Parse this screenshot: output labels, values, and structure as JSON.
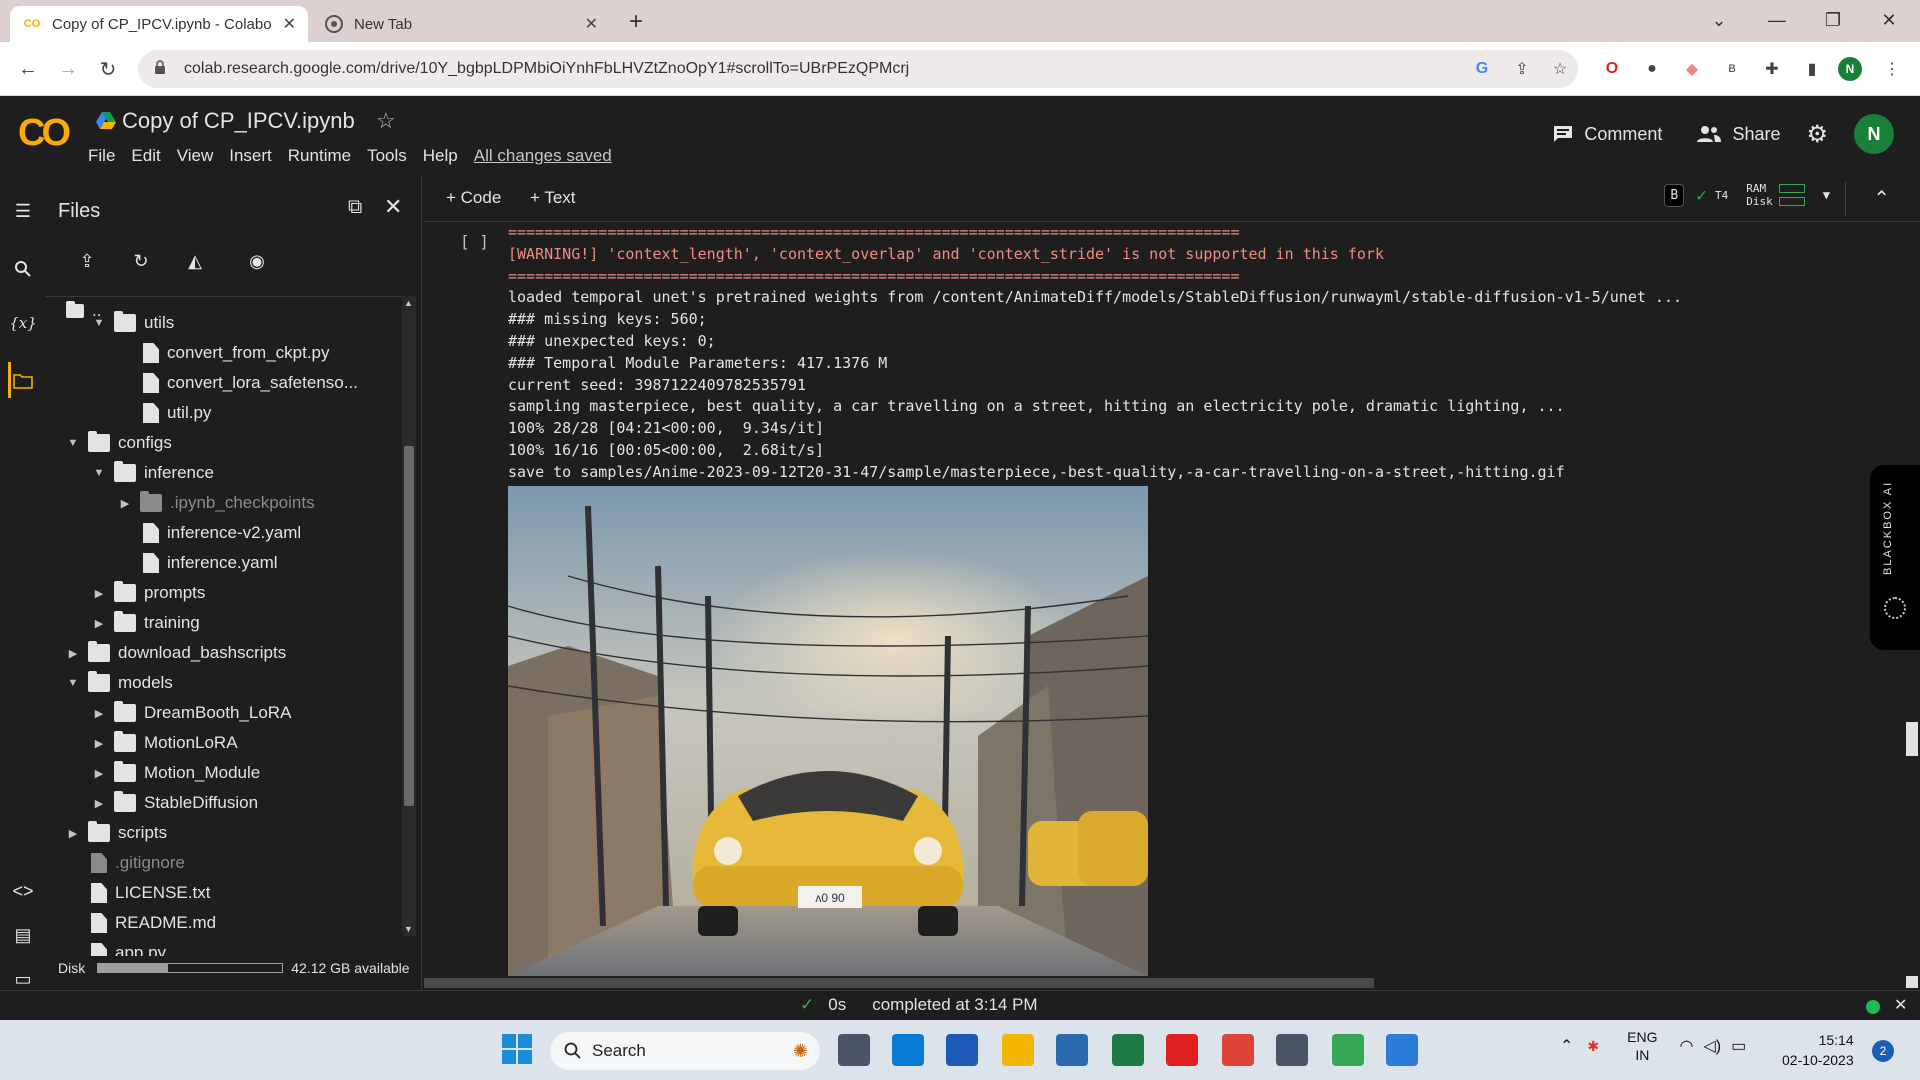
{
  "browser": {
    "tabs": [
      {
        "title": "Copy of CP_IPCV.ipynb - Colabo",
        "close": "✕"
      },
      {
        "title": "New Tab",
        "close": "✕"
      }
    ],
    "new_tab": "+",
    "url": "colab.research.google.com/drive/10Y_bgbpLDPMbiOiYnhFbLHVZtZnoOpY1#scrollTo=UBrPEzQPMcrj",
    "profile_initial": "N"
  },
  "colab": {
    "logo": "CO",
    "notebook_title": "Copy of CP_IPCV.ipynb",
    "menus": [
      "File",
      "Edit",
      "View",
      "Insert",
      "Runtime",
      "Tools",
      "Help"
    ],
    "save_status": "All changes saved",
    "comment_label": "Comment",
    "share_label": "Share",
    "user_initial": "N"
  },
  "files_panel": {
    "title": "Files",
    "up_dir": "..",
    "tree": [
      {
        "label": "utils",
        "type": "folder",
        "depth": 1,
        "expanded": true,
        "dim": false
      },
      {
        "label": "convert_from_ckpt.py",
        "type": "file",
        "depth": 2,
        "dim": false
      },
      {
        "label": "convert_lora_safetenso...",
        "type": "file",
        "depth": 2,
        "dim": false
      },
      {
        "label": "util.py",
        "type": "file",
        "depth": 2,
        "dim": false
      },
      {
        "label": "configs",
        "type": "folder",
        "depth": 0,
        "expanded": true,
        "dim": false
      },
      {
        "label": "inference",
        "type": "folder",
        "depth": 1,
        "expanded": true,
        "dim": false
      },
      {
        "label": ".ipynb_checkpoints",
        "type": "folder",
        "depth": 2,
        "expanded": false,
        "dim": true
      },
      {
        "label": "inference-v2.yaml",
        "type": "file",
        "depth": 2,
        "dim": false
      },
      {
        "label": "inference.yaml",
        "type": "file",
        "depth": 2,
        "dim": false
      },
      {
        "label": "prompts",
        "type": "folder",
        "depth": 1,
        "expanded": false,
        "dim": false
      },
      {
        "label": "training",
        "type": "folder",
        "depth": 1,
        "expanded": false,
        "dim": false
      },
      {
        "label": "download_bashscripts",
        "type": "folder",
        "depth": 0,
        "expanded": false,
        "dim": false
      },
      {
        "label": "models",
        "type": "folder",
        "depth": 0,
        "expanded": true,
        "dim": false
      },
      {
        "label": "DreamBooth_LoRA",
        "type": "folder",
        "depth": 1,
        "expanded": false,
        "dim": false
      },
      {
        "label": "MotionLoRA",
        "type": "folder",
        "depth": 1,
        "expanded": false,
        "dim": false
      },
      {
        "label": "Motion_Module",
        "type": "folder",
        "depth": 1,
        "expanded": false,
        "dim": false
      },
      {
        "label": "StableDiffusion",
        "type": "folder",
        "depth": 1,
        "expanded": false,
        "dim": false
      },
      {
        "label": "scripts",
        "type": "folder",
        "depth": 0,
        "expanded": false,
        "dim": false
      },
      {
        "label": ".gitignore",
        "type": "file",
        "depth": 0,
        "dim": true
      },
      {
        "label": "LICENSE.txt",
        "type": "file",
        "depth": 0,
        "dim": false
      },
      {
        "label": "README.md",
        "type": "file",
        "depth": 0,
        "dim": false
      },
      {
        "label": "app.py",
        "type": "file",
        "depth": 0,
        "dim": false
      }
    ],
    "disk_label": "Disk",
    "disk_available": "42.12 GB available",
    "disk_used_fraction": 0.38
  },
  "notebook": {
    "add_code": "+ Code",
    "add_text": "+ Text",
    "runtime_badge": "B",
    "gpu": "T4",
    "ram_label": "RAM",
    "disk_label": "Disk",
    "cell_bracket": "[ ]",
    "output_lines": [
      {
        "text": "=================================================================================",
        "warn": true
      },
      {
        "text": "[WARNING!] 'context_length', 'context_overlap' and 'context_stride' is not supported in this fork",
        "warn": true
      },
      {
        "text": "=================================================================================",
        "warn": true
      },
      {
        "text": "loaded temporal unet's pretrained weights from /content/AnimateDiff/models/StableDiffusion/runwayml/stable-diffusion-v1-5/unet ...",
        "warn": false
      },
      {
        "text": "### missing keys: 560;",
        "warn": false
      },
      {
        "text": "### unexpected keys: 0;",
        "warn": false
      },
      {
        "text": "### Temporal Module Parameters: 417.1376 M",
        "warn": false
      },
      {
        "text": "current seed: 3987122409782535791",
        "warn": false
      },
      {
        "text": "sampling masterpiece, best quality, a car travelling on a street, hitting an electricity pole, dramatic lighting, ...",
        "warn": false
      },
      {
        "text": "100% 28/28 [04:21<00:00,  9.34s/it]",
        "warn": false
      },
      {
        "text": "100% 16/16 [00:05<00:00,  2.68it/s]",
        "warn": false
      },
      {
        "text": "save to samples/Anime-2023-09-12T20-31-47/sample/masterpiece,-best-quality,-a-car-travelling-on-a-street,-hitting.gif",
        "warn": false
      }
    ],
    "image_plate": "ᴧ0 90"
  },
  "blackbox_widget": "BLACKBOX AI",
  "statusbar": {
    "check": "✓",
    "duration": "0s",
    "completed": "completed at 3:14 PM",
    "close": "✕"
  },
  "taskbar": {
    "search": "Search",
    "lang_top": "ENG",
    "lang_bottom": "IN",
    "time": "15:14",
    "date": "02-10-2023",
    "notifications": "2",
    "apps": [
      {
        "name": "camera-app",
        "color": "#4a5568"
      },
      {
        "name": "edge-app",
        "color": "#0a7cd6"
      },
      {
        "name": "word-app",
        "color": "#1e5bb8"
      },
      {
        "name": "explorer-app",
        "color": "#f2b705"
      },
      {
        "name": "wordpad-app",
        "color": "#2b6cb0"
      },
      {
        "name": "excel-app",
        "color": "#1d7a44"
      },
      {
        "name": "youtube-app",
        "color": "#e02020"
      },
      {
        "name": "chrome-m-app",
        "color": "#db4437"
      },
      {
        "name": "settings-app",
        "color": "#4a5568"
      },
      {
        "name": "chrome-n-app",
        "color": "#34a853"
      },
      {
        "name": "notepad-app",
        "color": "#2b7bd8"
      }
    ]
  }
}
